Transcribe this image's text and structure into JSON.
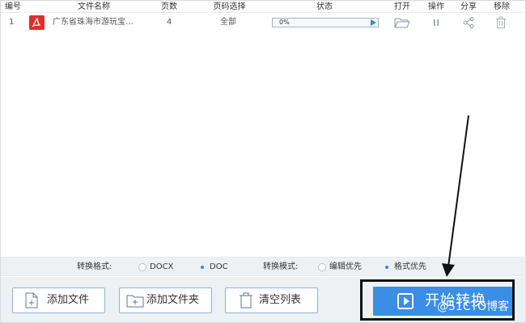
{
  "table": {
    "headers": {
      "index": "编号",
      "filename": "文件名称",
      "pages": "页数",
      "page_select": "页码选择",
      "status": "状态",
      "open": "打开",
      "operate": "操作",
      "share": "分享",
      "remove": "移除"
    },
    "rows": [
      {
        "index": "1",
        "file_icon": "pdf-icon",
        "filename": "广东省珠海市游玩宝…",
        "pages": "4",
        "page_select": "全部",
        "progress_text": "0%",
        "progress_value": 0,
        "open_icon": "folder-open-icon",
        "operate_icon": "pause-icon",
        "share_icon": "share-icon",
        "remove_icon": "trash-icon"
      }
    ]
  },
  "options": {
    "format_label": "转换格式:",
    "format_options": [
      "DOCX",
      "DOC"
    ],
    "format_selected": "DOC",
    "mode_label": "转换模式:",
    "mode_options": [
      "编辑优先",
      "格式优先"
    ],
    "mode_selected": "格式优先"
  },
  "buttons": {
    "add_file": "添加文件",
    "add_folder": "添加文件夹",
    "clear_list": "清空列表",
    "start": "开始转换"
  },
  "watermark": "@51CTO博客",
  "colors": {
    "accent": "#3a8ee6",
    "pdf_red": "#d9322b",
    "annotation": "#111111"
  }
}
